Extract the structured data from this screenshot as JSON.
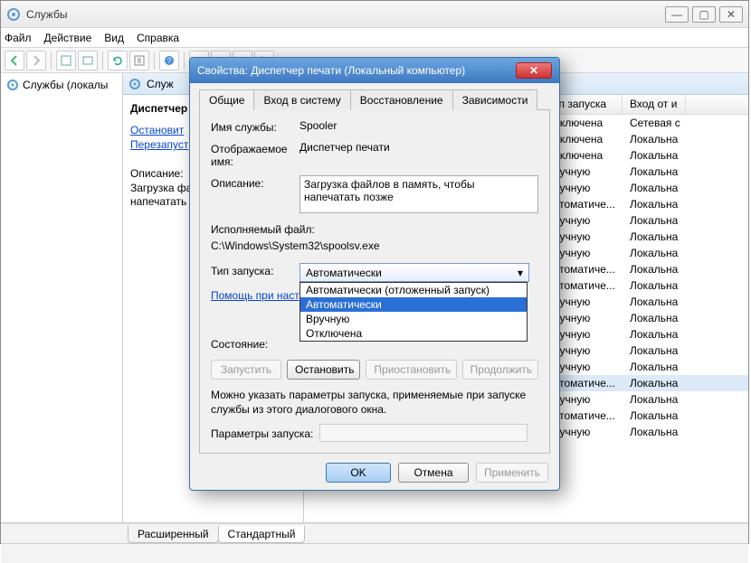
{
  "window": {
    "title": "Службы",
    "min_icon": "—",
    "max_icon": "▢",
    "close_icon": "✕"
  },
  "menu": {
    "file": "Файл",
    "action": "Действие",
    "view": "Вид",
    "help": "Справка"
  },
  "tree": {
    "root": "Службы (локалы"
  },
  "inner_header": "Служ",
  "left": {
    "name": "Диспетчер",
    "stop_link": "Остановит",
    "restart_link": "Перезапуст",
    "desc_label": "Описание:",
    "desc_text": "Загрузка фа\nнапечатать"
  },
  "columns": {
    "startup": "Тип запуска",
    "logon": "Вход от и"
  },
  "rows": [
    {
      "start": "Отключена",
      "logon": "Сетевая с"
    },
    {
      "start": "Отключена",
      "logon": "Локальна"
    },
    {
      "start": "Отключена",
      "logon": "Локальна"
    },
    {
      "start": "Вручную",
      "logon": "Локальна"
    },
    {
      "start": "Вручную",
      "logon": "Локальна"
    },
    {
      "start": "Автоматиче...",
      "logon": "Локальна"
    },
    {
      "start": "Вручную",
      "logon": "Локальна"
    },
    {
      "start": "Вручную",
      "logon": "Локальна"
    },
    {
      "start": "Вручную",
      "logon": "Локальна"
    },
    {
      "start": "Автоматиче...",
      "logon": "Локальна"
    },
    {
      "start": "Автоматиче...",
      "logon": "Локальна"
    },
    {
      "start": "Вручную",
      "logon": "Локальна"
    },
    {
      "start": "Вручную",
      "logon": "Локальна"
    },
    {
      "start": "Вручную",
      "logon": "Локальна"
    },
    {
      "start": "Вручную",
      "logon": "Локальна"
    },
    {
      "start": "Вручную",
      "logon": "Локальна"
    },
    {
      "start": "Автоматиче...",
      "logon": "Локальна",
      "sel": true
    },
    {
      "start": "Вручную",
      "logon": "Локальна"
    },
    {
      "start": "Автоматиче...",
      "logon": "Локальна"
    },
    {
      "start": "Вручную",
      "logon": "Локальна"
    }
  ],
  "bottom_tabs": {
    "ext": "Расширенный",
    "std": "Стандартный"
  },
  "dialog": {
    "title": "Свойства: Диспетчер печати (Локальный компьютер)",
    "close": "✕",
    "tabs": {
      "general": "Общие",
      "logon": "Вход в систему",
      "recovery": "Восстановление",
      "deps": "Зависимости"
    },
    "svc_name_lbl": "Имя службы:",
    "svc_name": "Spooler",
    "disp_name_lbl": "Отображаемое имя:",
    "disp_name": "Диспетчер печати",
    "desc_lbl": "Описание:",
    "desc": "Загрузка файлов в память, чтобы напечатать позже",
    "exe_lbl": "Исполняемый файл:",
    "exe": "C:\\Windows\\System32\\spoolsv.exe",
    "startup_lbl": "Тип запуска:",
    "startup_sel": "Автоматически",
    "options": {
      "delayed": "Автоматически (отложенный запуск)",
      "auto": "Автоматически",
      "manual": "Вручную",
      "disabled": "Отключена"
    },
    "help_link": "Помощь при настр",
    "state_lbl": "Состояние:",
    "btns": {
      "start": "Запустить",
      "stop": "Остановить",
      "pause": "Приостановить",
      "resume": "Продолжить"
    },
    "note": "Можно указать параметры запуска, применяемые при запуске службы из этого диалогового окна.",
    "params_lbl": "Параметры запуска:",
    "ok": "OK",
    "cancel": "Отмена",
    "apply": "Применить"
  }
}
